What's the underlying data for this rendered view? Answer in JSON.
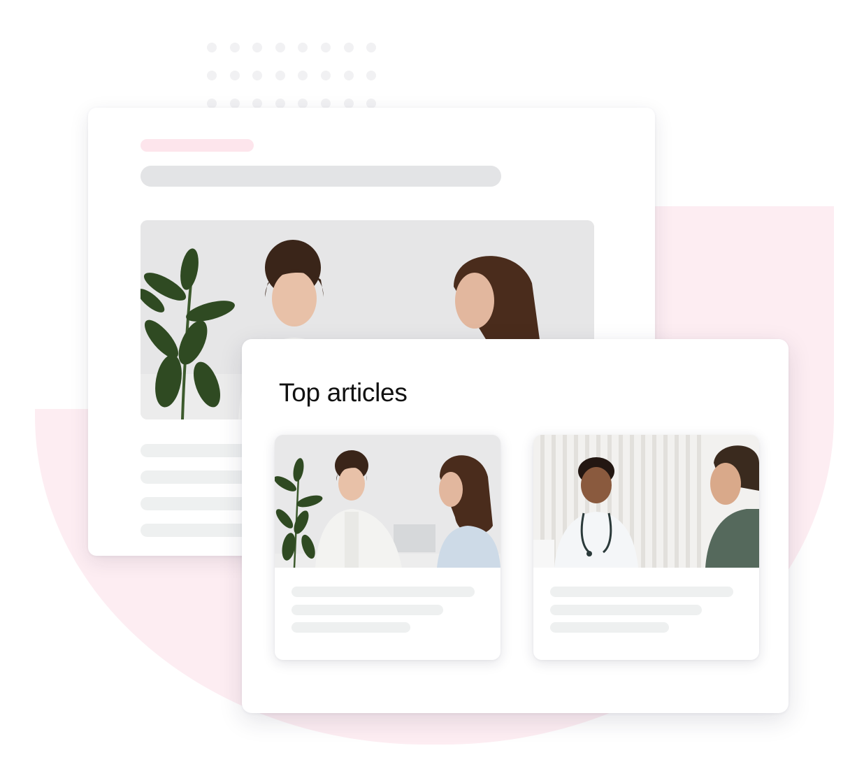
{
  "top_articles": {
    "heading": "Top articles",
    "articles": [
      {
        "image_icon": "doctor-consultation-photo-icon"
      },
      {
        "image_icon": "doctor-patient-photo-icon"
      }
    ]
  },
  "colors": {
    "accent_pink": "#fdedf2",
    "skeleton_pink": "#fde5ec",
    "skeleton_gray": "#e3e4e6",
    "skeleton_light": "#eef0f0"
  }
}
